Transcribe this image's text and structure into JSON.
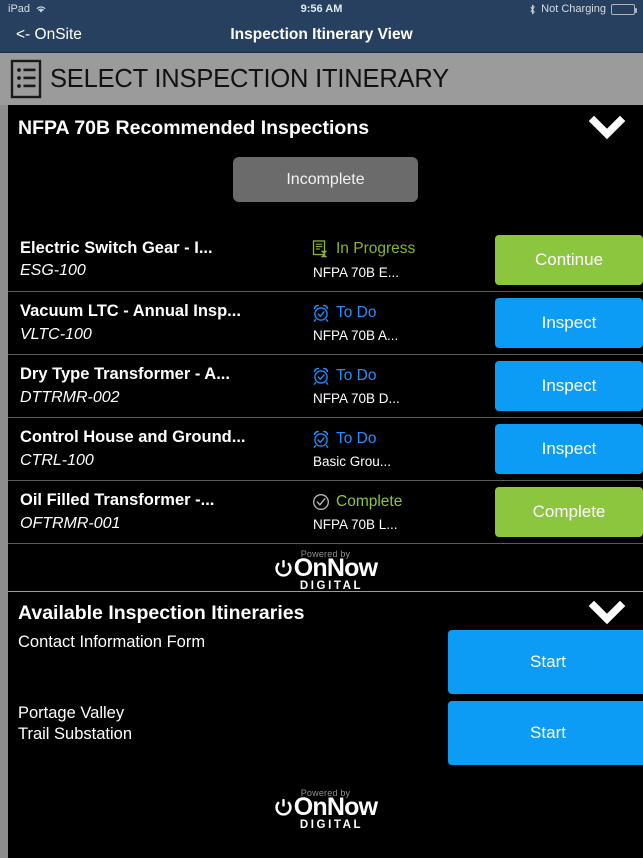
{
  "status_bar": {
    "device": "iPad",
    "wifi_icon": "wifi-icon",
    "time": "9:56 AM",
    "bluetooth_icon": "bluetooth-icon",
    "charging_text": "Not Charging",
    "battery_icon": "battery-icon"
  },
  "nav_bar": {
    "back_label": "<- OnSite",
    "title": "Inspection Itinerary View"
  },
  "page_header": {
    "icon": "list-document-icon",
    "title": "SELECT INSPECTION ITINERARY"
  },
  "recommended_section": {
    "title": "NFPA 70B Recommended Inspections",
    "collapse_icon": "chevron-down-icon",
    "filter_button": "Incomplete",
    "rows": [
      {
        "name": "Electric Switch Gear - I...",
        "id": "ESG-100",
        "status": "In Progress",
        "status_icon": "document-hourglass-icon",
        "status_color": "#8cb520",
        "subtitle": "NFPA 70B E...",
        "action": "Continue",
        "action_color": "#8cc63e"
      },
      {
        "name": "Vacuum LTC - Annual Insp...",
        "id": "VLTC-100",
        "status": "To Do",
        "status_icon": "alarm-clock-check-icon",
        "status_color": "#1e90ff",
        "subtitle": "NFPA 70B A...",
        "action": "Inspect",
        "action_color": "#0c9bf5"
      },
      {
        "name": "Dry Type Transformer - A...",
        "id": "DTTRMR-002",
        "status": "To Do",
        "status_icon": "alarm-clock-check-icon",
        "status_color": "#1e90ff",
        "subtitle": "NFPA 70B D...",
        "action": "Inspect",
        "action_color": "#0c9bf5"
      },
      {
        "name": "Control House and Ground...",
        "id": "CTRL-100",
        "status": "To Do",
        "status_icon": "alarm-clock-check-icon",
        "status_color": "#1e90ff",
        "subtitle": "Basic Grou...",
        "action": "Inspect",
        "action_color": "#0c9bf5"
      },
      {
        "name": "Oil Filled Transformer -...",
        "id": "OFTRMR-001",
        "status": "Complete",
        "status_icon": "circle-check-icon",
        "status_color": "#8cc63e",
        "subtitle": "NFPA 70B L...",
        "action": "Complete",
        "action_color": "#8cc63e"
      }
    ]
  },
  "available_section": {
    "title": "Available Inspection Itineraries",
    "collapse_icon": "chevron-down-icon",
    "rows": [
      {
        "name": "Contact Information Form",
        "action": "Start"
      },
      {
        "name": "Portage Valley\nTrail Substation",
        "action": "Start"
      }
    ]
  },
  "logo": {
    "powered_by": "Powered by",
    "brand": "OnNow",
    "sub": "DIGITAL",
    "power_icon": "power-symbol-icon"
  },
  "colors": {
    "navbar": "#27405f",
    "header_gray": "#9b9b9b",
    "green": "#8cc63e",
    "blue": "#0c9bf5",
    "todo_blue": "#1e90ff",
    "inprogress_olive": "#8cb520",
    "background": "#000000"
  }
}
